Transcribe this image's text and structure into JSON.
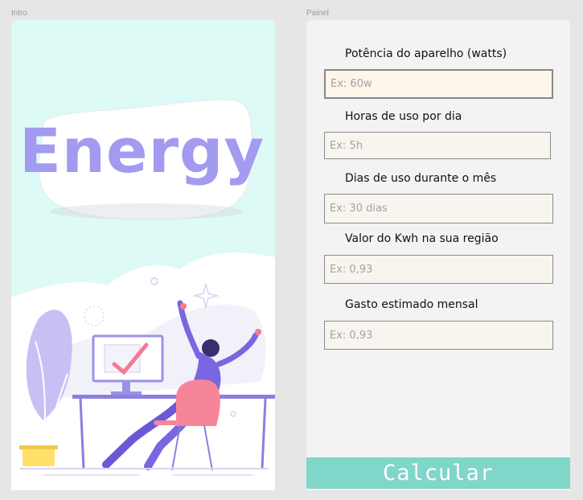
{
  "frames": {
    "intro_label": "Intro",
    "panel_label": "Painel"
  },
  "intro": {
    "logo": "Energy",
    "illustration": "person-celebrating-at-desk-illustration"
  },
  "panel": {
    "fields": [
      {
        "label": "Potência do aparelho (watts)",
        "placeholder": "Ex: 60w"
      },
      {
        "label": "Horas de uso por dia",
        "placeholder": "Ex: 5h"
      },
      {
        "label": "Dias de uso durante o mês",
        "placeholder": "Ex: 30 dias"
      },
      {
        "label": "Valor do Kwh na sua região",
        "placeholder": "Ex: 0,93"
      },
      {
        "label": "Gasto estimado mensal",
        "placeholder": "Ex: 0,93"
      }
    ],
    "calculate_label": "Calcular"
  },
  "colors": {
    "intro_bg": "#ddfaf6",
    "logo": "#a29bef",
    "button": "#7fd6c9",
    "input_bg": "#f8f5ef"
  }
}
